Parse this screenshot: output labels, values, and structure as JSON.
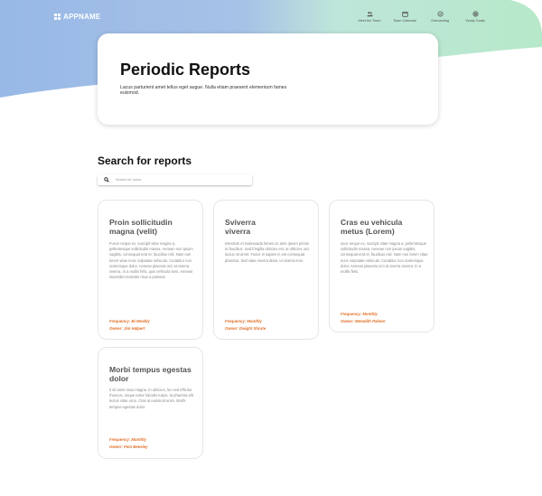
{
  "app": {
    "name": "APPNAME"
  },
  "nav": [
    {
      "label": "Meet the Team",
      "icon": "people-icon"
    },
    {
      "label": "Team Calendar",
      "icon": "calendar-icon"
    },
    {
      "label": "Onboarding",
      "icon": "badge-check-icon"
    },
    {
      "label": "Yearly Goals",
      "icon": "target-icon"
    }
  ],
  "header": {
    "title": "Periodic Reports",
    "subtitle": "Lacus parturient amet tellus eget augue. Nulla etiam praesent elementum fames euismod."
  },
  "search": {
    "title": "Search for reports",
    "placeholder": "Search for topics"
  },
  "reports": [
    {
      "title": "Proin sollicitudin magna (velit)",
      "body": "Fusce neque ex, suscipit vitae magna a, pellentesque sollicitudin massa. Aenean non ipsum sagittis, consequat erat et, faucibus nisl. Nam non lorem vitae nunc vulputate vehicula. Curabitur non scelerisque dolor. Aenean placerat orci at viverra viverra. In a mollis felis, quis vehicula sem. Aenean imperdiet molestie risus a pulvinar.",
      "frequency": "Frequency: Bi-Weekly",
      "owner": "Owner: Jim Halpert"
    },
    {
      "title": "Sviverra viverra",
      "body": "Interdum et malesuada fames ac ante ipsum primis in faucibus. Sed fringilla ultricies est, at ultricies orci luctus sit amet. Fusce in sapien in est consequat pharetra. Sed vitae viverra diam, ut viverra eros.",
      "frequency": "Frequency: Monthly",
      "owner": "Owner: Dwight Shrute"
    },
    {
      "title": "Cras eu vehicula metus (Lorem)",
      "body": "usce neque ex, suscipit vitae magna a, pellentesque sollicitudin massa. Aenean non ipsum sagittis, consequat erat et, faucibus nisl. Nam non lorem vitae nunc vulputate vehicula. Curabitur non scelerisque dolor. Aenean placerat orci at viverra viverra. In a mollis felis,",
      "frequency": "Frequency: Monthly",
      "owner": "Owner: Meredith Palmer"
    },
    {
      "title": "Morbi tempus egestas dolor",
      "body": "it sit amet risus magna. In ultricies, leo sed efficitur rhoncus, neque tortor lobortis turpis, at pharetra elit lectus vitae urna. Cras at euismod enim. Morbi tempus egestas dolor.",
      "frequency": "Frequency: Monthly",
      "owner": "Owner: Pam Beesley"
    }
  ],
  "colors": {
    "accent": "#e0702a",
    "hero_left": "#98b8e6",
    "hero_right": "#b8e8cc"
  }
}
